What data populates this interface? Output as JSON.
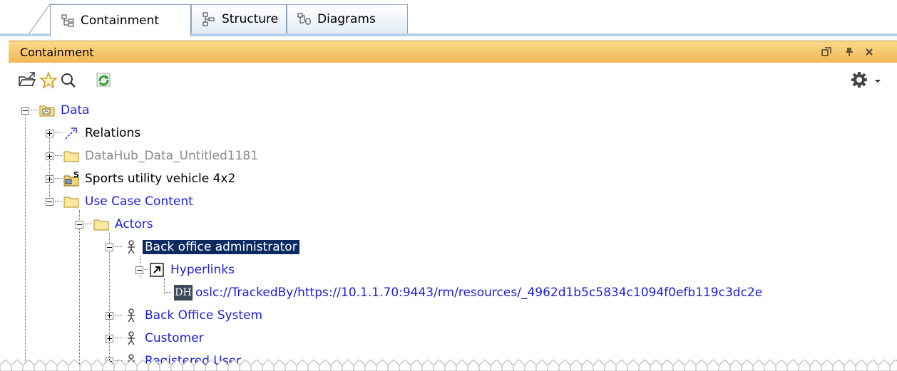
{
  "tabs": [
    {
      "label": "Containment",
      "icon": "containment-tree-icon",
      "active": true
    },
    {
      "label": "Structure",
      "icon": "structure-tree-icon",
      "active": false
    },
    {
      "label": "Diagrams",
      "icon": "diagrams-icon",
      "active": false
    }
  ],
  "panel": {
    "title": "Containment",
    "window_buttons": [
      "restore-icon",
      "pin-icon",
      "close-icon"
    ],
    "toolbar_icons": [
      "open-folder-icon",
      "favorite-star-icon",
      "search-icon",
      "refresh-sync-icon"
    ],
    "options_icon": "gear-icon"
  },
  "tree": {
    "root": {
      "label": "Data"
    },
    "relations": {
      "label": "Relations"
    },
    "datahub": {
      "label": "DataHub_Data_Untitled1181"
    },
    "suv": {
      "label": "Sports utility vehicle 4x2"
    },
    "usecase": {
      "label": "Use Case Content"
    },
    "actors": {
      "label": "Actors"
    },
    "boa": {
      "label": "Back office administrator"
    },
    "hyperlinks": {
      "label": "Hyperlinks"
    },
    "oslc": {
      "label": "oslc://TrackedBy/https://10.1.1.70:9443/rm/resources/_4962d1b5c5834c1094f0efb119c3dc2e",
      "badge": "DH"
    },
    "bos": {
      "label": "Back Office System"
    },
    "customer": {
      "label": "Customer"
    },
    "reguser": {
      "label": "Registered User"
    }
  },
  "colors": {
    "title_bar": "#f1b855",
    "selection": "#0a2a61",
    "link_text": "#1d1ddb",
    "tab_band": "#b8cfe8"
  }
}
